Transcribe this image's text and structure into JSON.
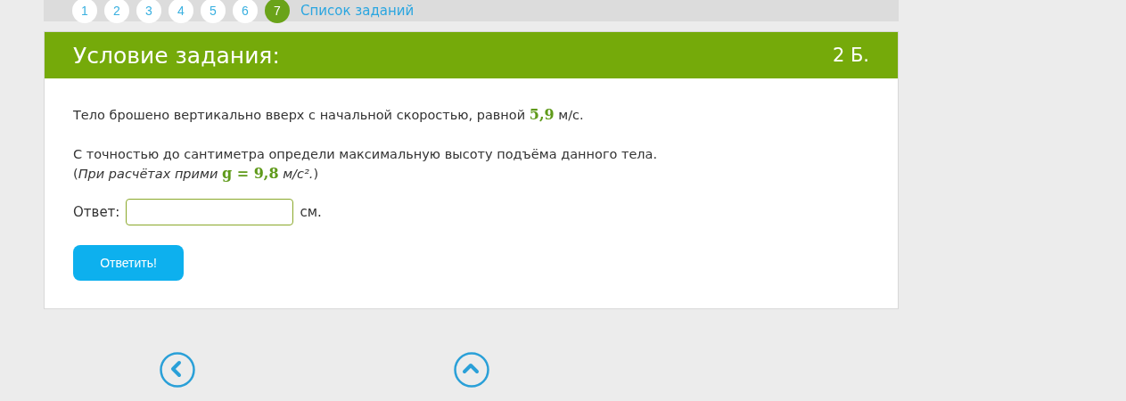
{
  "pagination": {
    "pages": [
      {
        "label": "1",
        "selected": false
      },
      {
        "label": "2",
        "selected": false
      },
      {
        "label": "3",
        "selected": false
      },
      {
        "label": "4",
        "selected": false
      },
      {
        "label": "5",
        "selected": false
      },
      {
        "label": "6",
        "selected": false
      },
      {
        "label": "7",
        "selected": true
      }
    ],
    "task_list_link": "Список заданий"
  },
  "task": {
    "title": "Условие задания:",
    "points": "2 Б.",
    "paragraphs": [
      [
        {
          "kind": "text",
          "text": "Тело брошено вертикально вверх с начальной скоростью, равной "
        },
        {
          "kind": "math",
          "text": "5,9"
        },
        {
          "kind": "text",
          "text": " м/с."
        }
      ],
      [
        {
          "kind": "text",
          "text": "С точностью до сантиметра определи максимальную высоту подъёма данного тела."
        }
      ],
      [
        {
          "kind": "text",
          "text": "("
        },
        {
          "kind": "italic",
          "text": "При расчётах прими "
        },
        {
          "kind": "math",
          "text": "g = 9,8"
        },
        {
          "kind": "italic",
          "text": " м/с²."
        },
        {
          "kind": "text",
          "text": ")"
        }
      ]
    ],
    "answer_label": "Ответ:",
    "answer_unit": "см.",
    "submit": "Ответить!"
  },
  "nav": [
    {
      "kind": "back"
    },
    {
      "kind": "up"
    }
  ]
}
